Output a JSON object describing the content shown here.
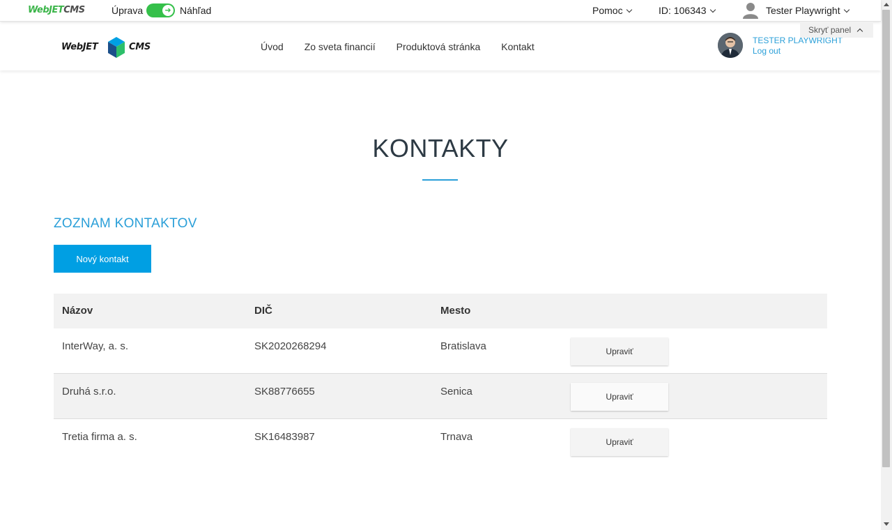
{
  "adminbar": {
    "logo_part1": "WebJET",
    "logo_part2": "CMS",
    "mode_edit": "Úprava",
    "mode_preview": "Náhľad",
    "help": "Pomoc",
    "page_id": "ID: 106343",
    "user": "Tester Playwright",
    "hide_panel": "Skryť panel"
  },
  "site": {
    "logo_left": "WebJET",
    "logo_right": "CMS",
    "nav": [
      "Úvod",
      "Zo sveta financií",
      "Produktová stránka",
      "Kontakt"
    ],
    "profile_name": "TESTER PLAYWRIGHT",
    "logout": "Log out"
  },
  "main": {
    "title": "KONTAKTY",
    "section_title": "ZOZNAM KONTAKTOV",
    "new_button": "Nový kontakt",
    "columns": [
      "Názov",
      "DIČ",
      "Mesto"
    ],
    "rows": [
      {
        "name": "InterWay, a. s.",
        "dic": "SK2020268294",
        "city": "Bratislava",
        "action": "Upraviť"
      },
      {
        "name": "Druhá s.r.o.",
        "dic": "SK88776655",
        "city": "Senica",
        "action": "Upraviť"
      },
      {
        "name": "Tretia firma a. s.",
        "dic": "SK16483987",
        "city": "Trnava",
        "action": "Upraviť"
      }
    ]
  },
  "colors": {
    "accent": "#009fe3",
    "toggle": "#35c04a",
    "link": "#2a9fd8"
  }
}
